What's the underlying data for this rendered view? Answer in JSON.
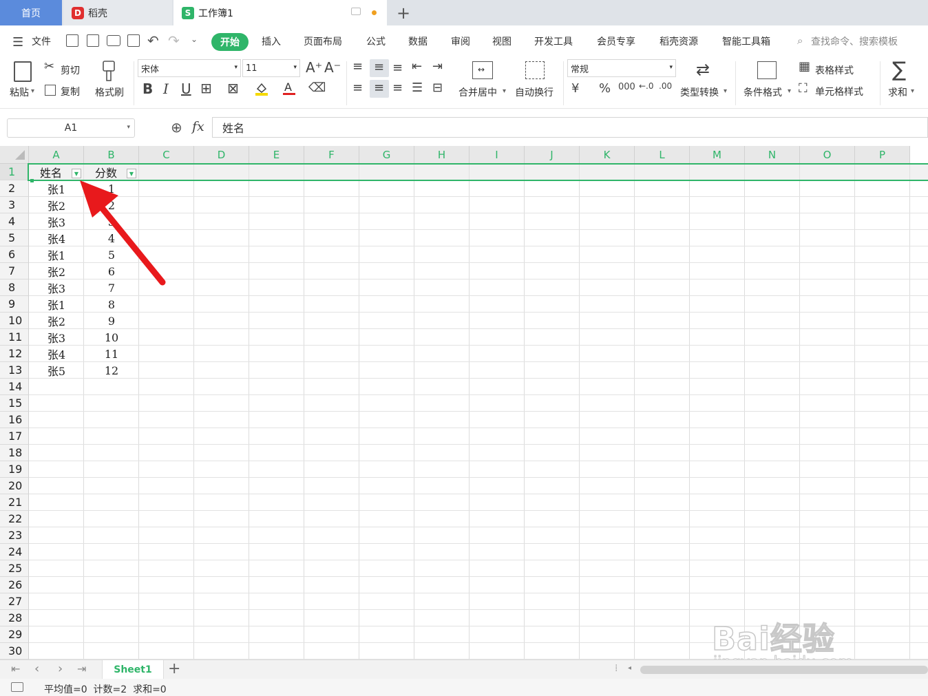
{
  "tabs": {
    "home": "首页",
    "daoke": "稻壳",
    "workbook": "工作簿1",
    "add": "+"
  },
  "menu": {
    "file": "文件",
    "start": "开始",
    "items": [
      "插入",
      "页面布局",
      "公式",
      "数据",
      "审阅",
      "视图",
      "开发工具",
      "会员专享",
      "稻壳资源",
      "智能工具箱"
    ],
    "search": "查找命令、搜索模板"
  },
  "ribbon": {
    "paste": "粘贴",
    "cut": "剪切",
    "copy": "复制",
    "format_painter": "格式刷",
    "font": "宋体",
    "size": "11",
    "merge": "合并居中",
    "wrap": "自动换行",
    "number_format": "常规",
    "type_convert": "类型转换",
    "cond_format": "条件格式",
    "table_style": "表格样式",
    "cell_style": "单元格样式",
    "sum": "求和",
    "currency": "¥",
    "percent": "%",
    "thousands": "000"
  },
  "formula": {
    "cell_ref": "A1",
    "fx": "fx",
    "content": "姓名"
  },
  "columns": [
    "A",
    "B",
    "C",
    "D",
    "E",
    "F",
    "G",
    "H",
    "I",
    "J",
    "K",
    "L",
    "M",
    "N",
    "O",
    "P"
  ],
  "rows": [
    "1",
    "2",
    "3",
    "4",
    "5",
    "6",
    "7",
    "8",
    "9",
    "10",
    "11",
    "12",
    "13",
    "14",
    "15",
    "16",
    "17",
    "18",
    "19",
    "20",
    "21",
    "22",
    "23",
    "24",
    "25",
    "26",
    "27",
    "28",
    "29",
    "30"
  ],
  "table": {
    "headers": [
      "姓名",
      "分数"
    ],
    "data": [
      [
        "张1",
        "1"
      ],
      [
        "张2",
        "2"
      ],
      [
        "张3",
        "3"
      ],
      [
        "张4",
        "4"
      ],
      [
        "张1",
        "5"
      ],
      [
        "张2",
        "6"
      ],
      [
        "张3",
        "7"
      ],
      [
        "张1",
        "8"
      ],
      [
        "张2",
        "9"
      ],
      [
        "张3",
        "10"
      ],
      [
        "张4",
        "11"
      ],
      [
        "张5",
        "12"
      ]
    ]
  },
  "sheet": {
    "name": "Sheet1",
    "add": "+"
  },
  "status": {
    "text": "平均值=0  计数=2  求和=0"
  },
  "watermark": {
    "line1": "Bai经验",
    "line2": "jingyan.baidu.com"
  },
  "colors": {
    "accent": "#2fb569",
    "home_tab": "#5b8bdc",
    "arrow": "#e8191c"
  }
}
